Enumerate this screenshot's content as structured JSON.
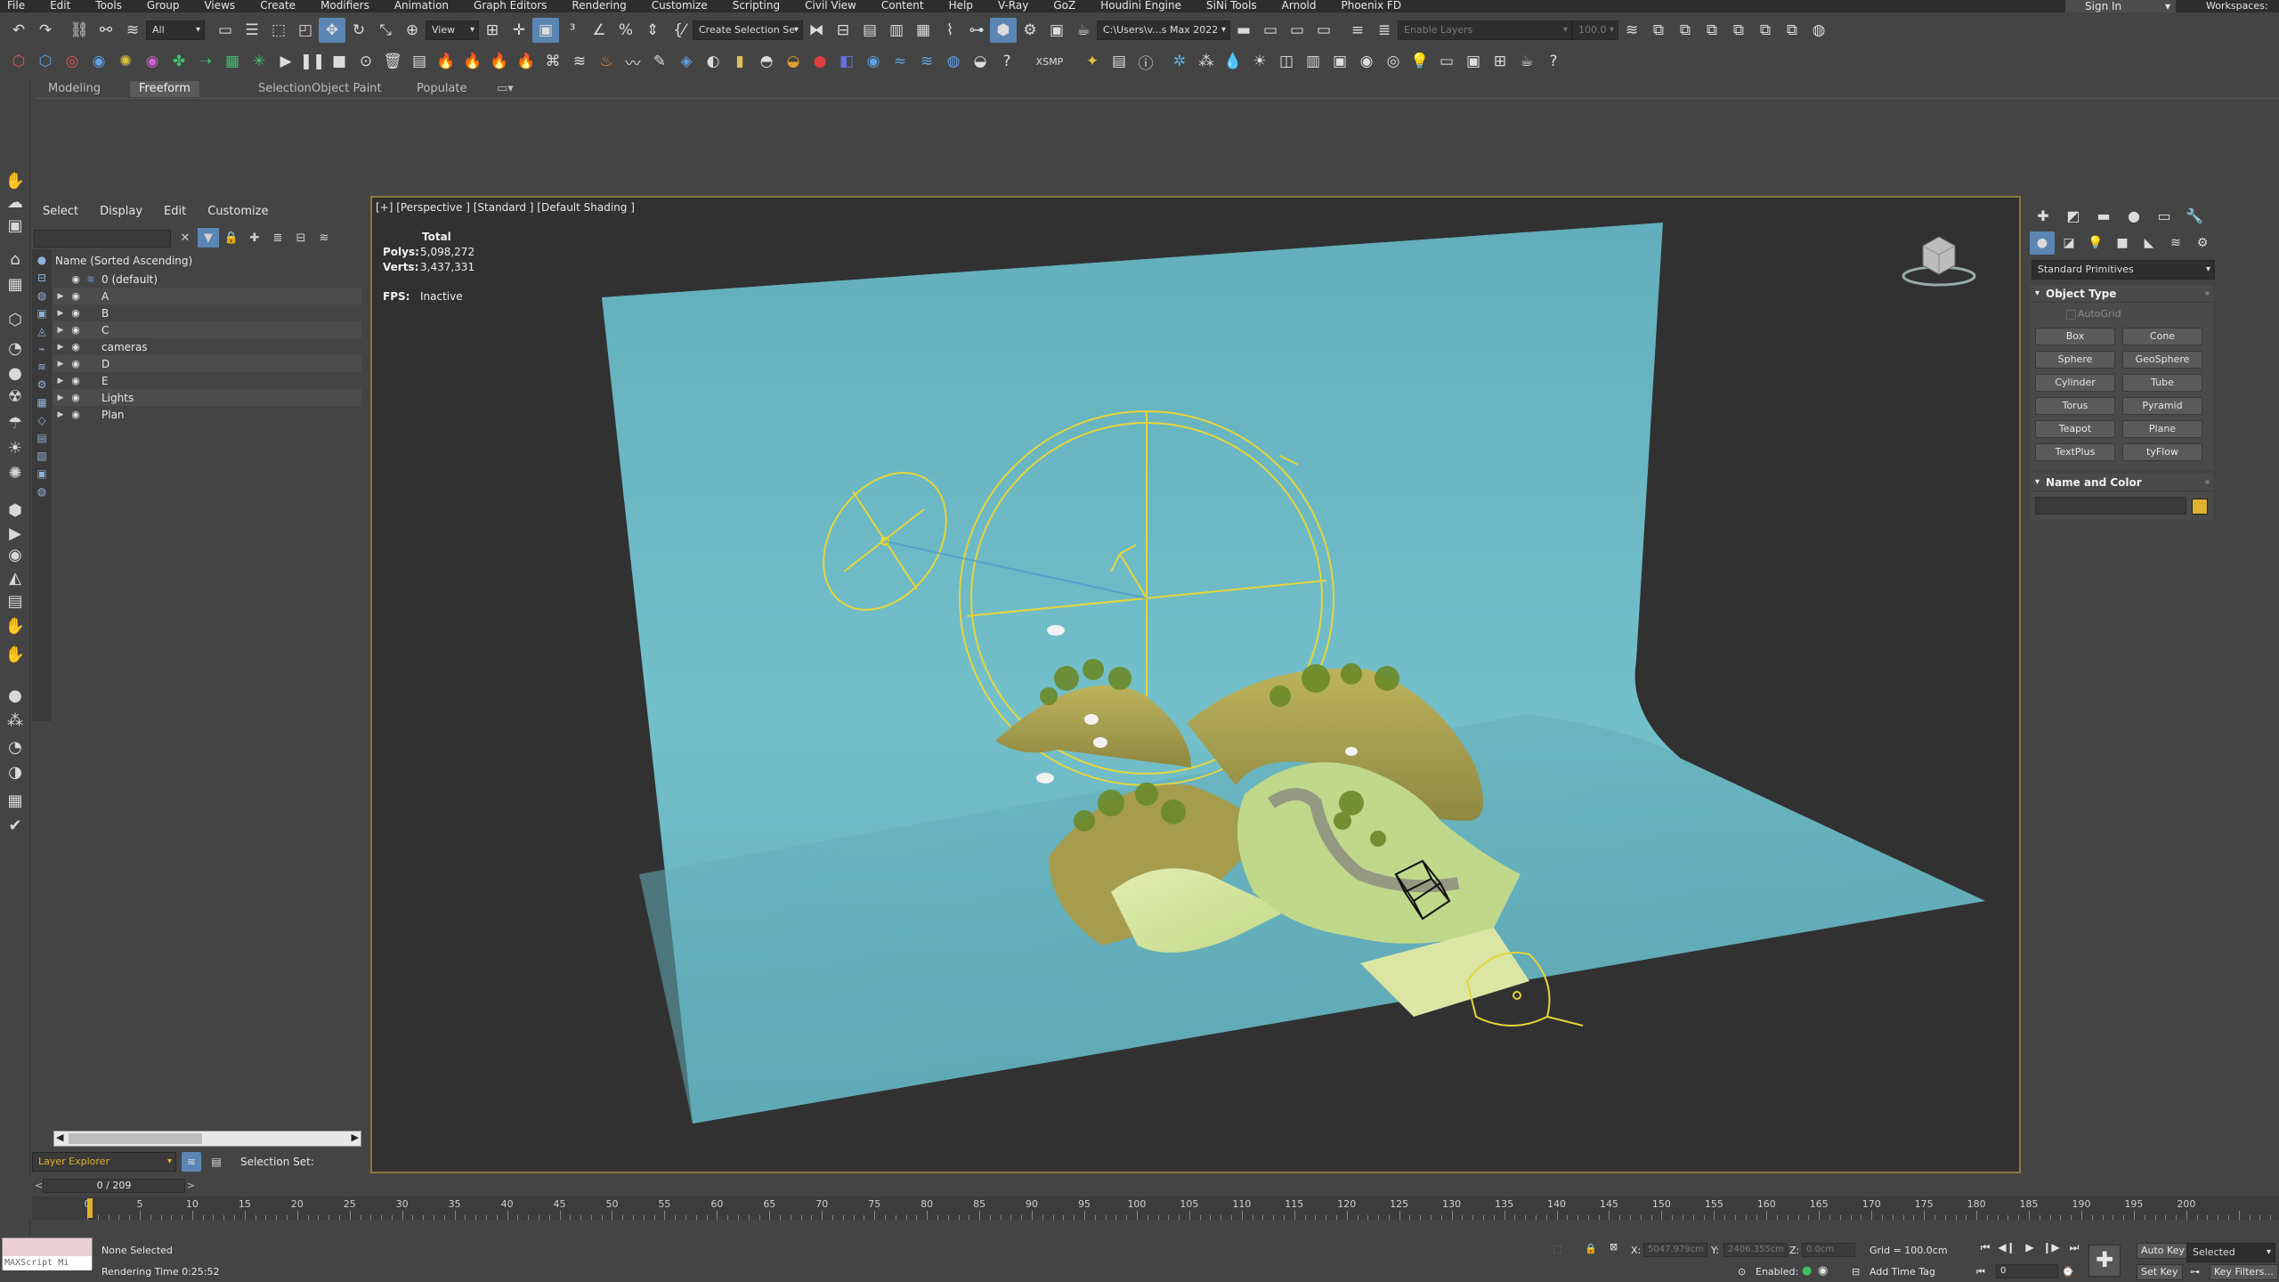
{
  "menu": [
    "File",
    "Edit",
    "Tools",
    "Group",
    "Views",
    "Create",
    "Modifiers",
    "Animation",
    "Graph Editors",
    "Rendering",
    "Customize",
    "Scripting",
    "Civil View",
    "Content",
    "Help",
    "V-Ray",
    "GoZ",
    "Houdini Engine",
    "SiNi Tools",
    "Arnold",
    "Phoenix FD"
  ],
  "account": {
    "signin": "Sign In",
    "workspaces": "Workspaces:"
  },
  "toolbar": {
    "undo_icon": "undo-icon",
    "redo_icon": "redo-icon",
    "filter_value": "All",
    "refcoord_value": "View",
    "named_selection": "Create Selection Se",
    "path_value": "C:\\Users\\v...s Max 2022",
    "layer_dd": "Enable Layers",
    "percent": "100.0",
    "xsmp": "XSMP"
  },
  "ribbon_tabs": [
    "Modeling",
    "Freeform",
    "Selection",
    "Object Paint",
    "Populate"
  ],
  "ribbon_active": "Freeform",
  "explorer": {
    "menu": [
      "Select",
      "Display",
      "Edit",
      "Customize"
    ],
    "header": "Name (Sorted Ascending)",
    "layers": [
      {
        "label": "0 (default)",
        "expanded": false,
        "root": true
      },
      {
        "label": "A"
      },
      {
        "label": "B"
      },
      {
        "label": "C"
      },
      {
        "label": "cameras"
      },
      {
        "label": "D"
      },
      {
        "label": "E"
      },
      {
        "label": "Lights"
      },
      {
        "label": "Plan"
      }
    ],
    "footer_dd": "Layer Explorer",
    "selection_set": "Selection Set:"
  },
  "viewport": {
    "label": "[+] [Perspective ] [Standard ] [Default Shading ]",
    "stats": {
      "total": "Total",
      "polys_label": "Polys:",
      "polys": "5,098,272",
      "verts_label": "Verts:",
      "verts": "3,437,331",
      "fps_label": "FPS:",
      "fps": "Inactive"
    },
    "colors": {
      "backdrop": "#67b3c1",
      "backdrop_dark": "#5aa1ad",
      "gizmo": "#e6d53a",
      "terrain": "#b7aa58",
      "terrain_light": "#dbe6a4",
      "foliage": "#6b8a2a"
    }
  },
  "cmd": {
    "primitive_type": "Standard Primitives",
    "object_type": "Object Type",
    "autogrid": "AutoGrid",
    "buttons": [
      "Box",
      "Cone",
      "Sphere",
      "GeoSphere",
      "Cylinder",
      "Tube",
      "Torus",
      "Pyramid",
      "Teapot",
      "Plane",
      "TextPlus",
      "tyFlow"
    ],
    "name_color": "Name and Color",
    "swatch": "#e0b030"
  },
  "timeline": {
    "frame": "0 / 209",
    "ticks": [
      0,
      5,
      10,
      15,
      20,
      25,
      30,
      35,
      40,
      45,
      50,
      55,
      60,
      65,
      70,
      75,
      80,
      85,
      90,
      95,
      100,
      105,
      110,
      115,
      120,
      125,
      130,
      135,
      140,
      145,
      150,
      155,
      160,
      165,
      170,
      175,
      180,
      185,
      190,
      195,
      200
    ],
    "end": 209
  },
  "status": {
    "maxscript": "MAXScript Mi",
    "selected": "None Selected",
    "render_time": "Rendering Time  0:25:52",
    "x_label": "X:",
    "x": "5047.979cm",
    "y_label": "Y:",
    "y": "2406.355cm",
    "z_label": "Z:",
    "z": "0.0cm",
    "grid": "Grid = 100.0cm",
    "enabled": "Enabled:",
    "add_time_tag": "Add Time Tag",
    "auto_key": "Auto Key",
    "selected_dd": "Selected",
    "set_key": "Set Key",
    "key_filters": "Key Filters...",
    "frame_field": "0"
  }
}
